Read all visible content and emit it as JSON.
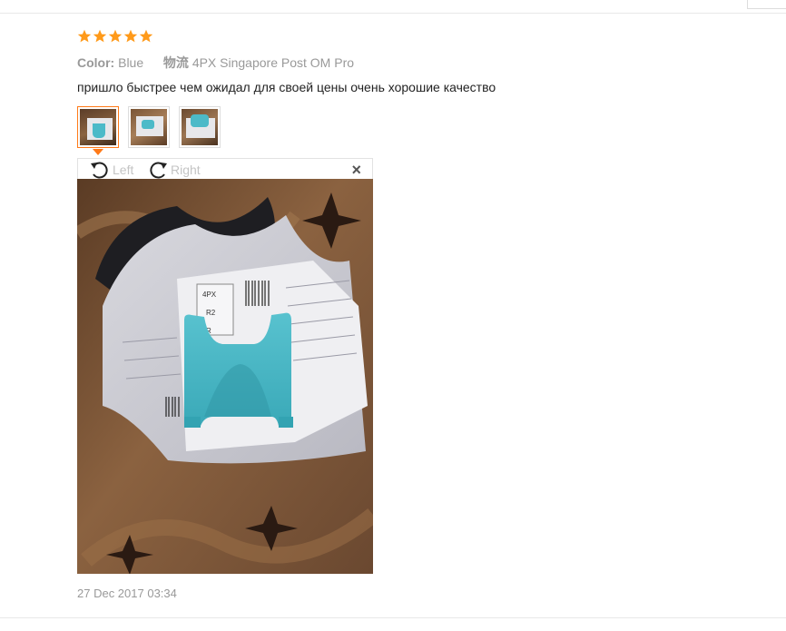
{
  "review": {
    "rating": 5,
    "rating_max": 5,
    "color_label": "Color:",
    "color_value": "Blue",
    "shipping_label": "物流",
    "shipping_value": "4PX Singapore Post OM Pro",
    "text": "пришло быстрее чем ожидал для своей цены очень хорошие качество",
    "date": "27 Dec 2017 03:34"
  },
  "viewer": {
    "rotate_left_label": "Left",
    "rotate_right_label": "Right",
    "close_symbol": "×",
    "thumbnail_count": 3,
    "active_thumbnail": 1
  },
  "photo_text": {
    "label_code": "4PX",
    "label_line": "R2",
    "label_r": "R"
  },
  "colors": {
    "star": "#ff9a1a",
    "active_border": "#ff7a18",
    "muted_text": "#999999",
    "product_blue": "#4cbac8"
  },
  "icons": {
    "rotate_left": "rotate-left-icon",
    "rotate_right": "rotate-right-icon",
    "close": "close-icon",
    "star": "star-icon"
  }
}
